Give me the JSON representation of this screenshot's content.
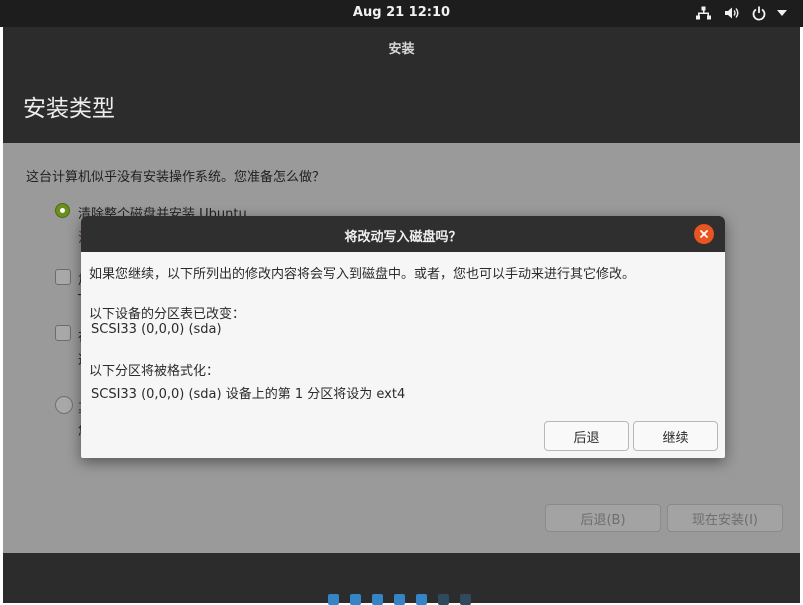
{
  "topbar": {
    "clock": "Aug 21  12:10",
    "icons": [
      "network-icon",
      "volume-icon",
      "power-icon",
      "chevron-down-icon"
    ]
  },
  "window": {
    "title": "安装",
    "page_title": "安装类型"
  },
  "main": {
    "question": "这台计算机似乎没有安装操作系统。您准备怎么做？",
    "options": [
      {
        "label": "清除整个磁盘并安装 Ubuntu",
        "type": "radio",
        "selected": true,
        "subtext_fragment": "注"
      },
      {
        "type": "checkbox",
        "label_fragment": "加",
        "subtext_fragment": "T"
      },
      {
        "type": "checkbox",
        "label_fragment": "在",
        "subtext_fragment": "这"
      },
      {
        "type": "radio",
        "selected": false,
        "label_fragment": "其",
        "subtext_fragment": "您"
      }
    ],
    "back_button": "后退(B)",
    "install_button": "现在安装(I)"
  },
  "progress": {
    "total_dots": 7,
    "active_dots": 5
  },
  "dialog": {
    "title": "将改动写入磁盘吗？",
    "intro": "如果您继续，以下所列出的修改内容将会写入到磁盘中。或者，您也可以手动来进行其它修改。",
    "partition_header": "以下设备的分区表已改变：",
    "partition_device": "SCSI33 (0,0,0) (sda)",
    "format_header": "以下分区将被格式化：",
    "format_detail": "SCSI33 (0,0,0) (sda) 设备上的第 1 分区将设为 ext4",
    "back_label": "后退",
    "continue_label": "继续"
  },
  "colors": {
    "accent": "#e95420",
    "selected_radio": "#6a8f20",
    "progress_dot": "#3584c6",
    "header_bg": "#2c2c2c"
  }
}
